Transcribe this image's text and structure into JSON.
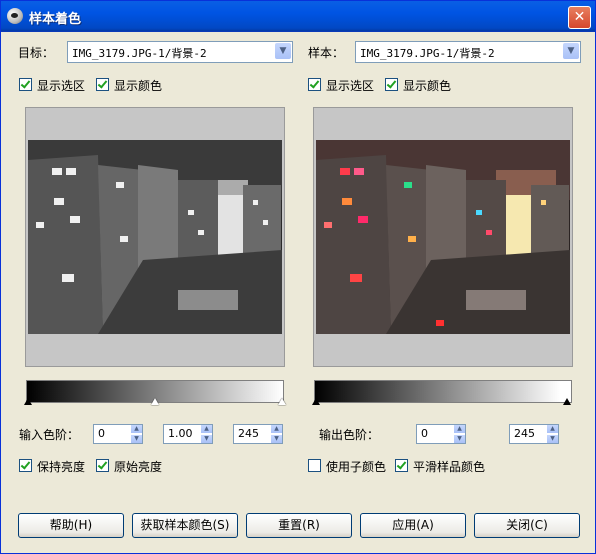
{
  "window": {
    "title": "样本着色",
    "close_glyph": "✕"
  },
  "target": {
    "label": "目标：",
    "combo_value": "IMG_3179.JPG-1/背景-2",
    "show_selection": "显示选区",
    "show_color": "显示颜色",
    "input_levels_label": "输入色阶：",
    "input_levels": {
      "low": "0",
      "gamma": "1.00",
      "high": "245"
    },
    "keep_brightness": "保持亮度",
    "original_brightness": "原始亮度",
    "gradient_marker_positions": [
      0.0,
      0.5,
      1.0
    ]
  },
  "sample": {
    "label": "样本：",
    "combo_value": "IMG_3179.JPG-1/背景-2",
    "show_selection": "显示选区",
    "show_color": "显示颜色",
    "output_levels_label": "输出色阶：",
    "output_levels": {
      "low": "0",
      "high": "245"
    },
    "use_subcolors": "使用子颜色",
    "smooth_sample_colors": "平滑样品颜色",
    "gradient_marker_positions": [
      0.0,
      0.96
    ]
  },
  "checks": {
    "target_show_selection": true,
    "target_show_color": true,
    "keep_brightness": true,
    "original_brightness": true,
    "sample_show_selection": true,
    "sample_show_color": true,
    "use_subcolors": false,
    "smooth_sample_colors": true
  },
  "buttons": {
    "help": "帮助(H)",
    "get_sample_colors": "获取样本颜色(S)",
    "reset": "重置(R)",
    "apply": "应用(A)",
    "close": "关闭(C)"
  },
  "icons": {
    "dropdown": "chevron-down-icon",
    "spin_up": "▲",
    "spin_down": "▼"
  }
}
